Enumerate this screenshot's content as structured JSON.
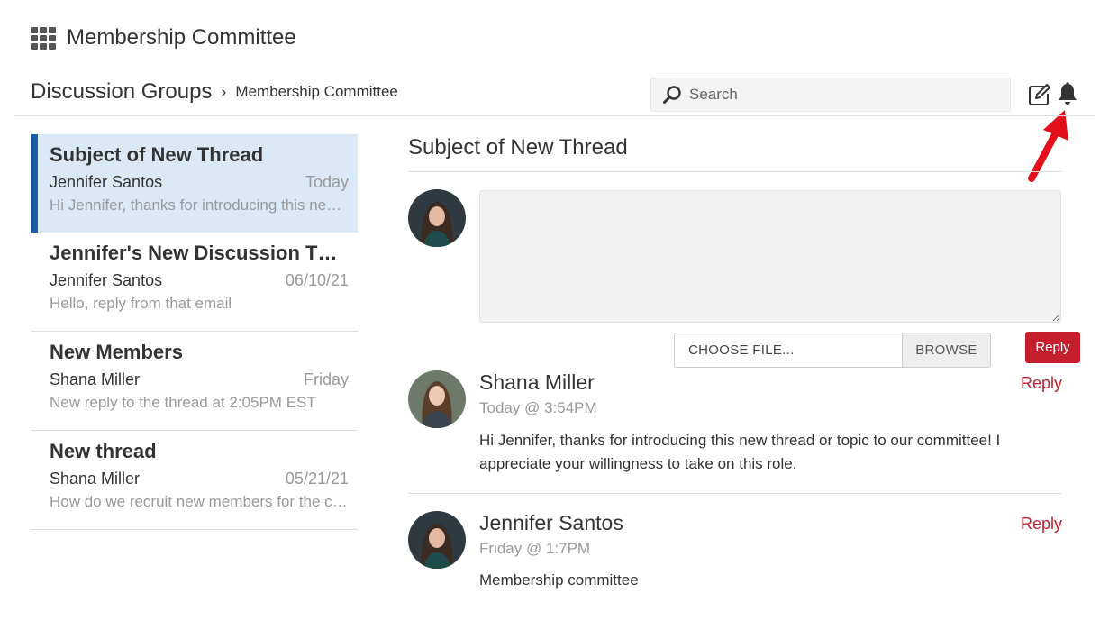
{
  "app": {
    "title": "Membership Committee"
  },
  "breadcrumb": {
    "root": "Discussion Groups",
    "separator": "›",
    "current": "Membership Committee"
  },
  "search": {
    "placeholder": "Search"
  },
  "threads": [
    {
      "subject": "Subject of New Thread",
      "author": "Jennifer Santos",
      "date": "Today",
      "preview": "Hi Jennifer, thanks for introducing this new thread or topic to our committee!",
      "selected": true
    },
    {
      "subject": "Jennifer's New Discussion Thread",
      "author": "Jennifer Santos",
      "date": "06/10/21",
      "preview": "Hello, reply from that email",
      "selected": false
    },
    {
      "subject": "New Members",
      "author": "Shana Miller",
      "date": "Friday",
      "preview": "New reply to the thread at 2:05PM EST",
      "selected": false
    },
    {
      "subject": "New thread",
      "author": "Shana Miller",
      "date": "05/21/21",
      "preview": "How do we recruit new members for the committee?",
      "selected": false
    }
  ],
  "detail": {
    "title": "Subject of New Thread",
    "file_label": "CHOOSE FILE...",
    "browse_label": "BROWSE",
    "submit_label": "Reply",
    "posts": [
      {
        "author": "Shana Miller",
        "time": "Today @ 3:54PM",
        "body": "Hi Jennifer, thanks for introducing this new thread or topic to our committee! I appreciate your willingness to take on this role.",
        "reply_label": "Reply"
      },
      {
        "author": "Jennifer Santos",
        "time": "Friday @ 1:7PM",
        "body": "Membership committee",
        "reply_label": "Reply"
      }
    ]
  },
  "colors": {
    "accent": "#1b5ea6",
    "reply": "#c51f2e",
    "selected_bg": "#dbe9f7"
  }
}
